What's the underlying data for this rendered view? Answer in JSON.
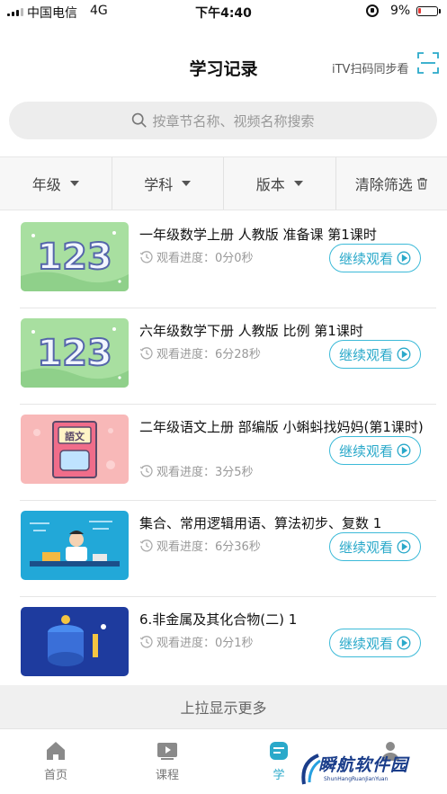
{
  "status_bar": {
    "carrier": "中国电信",
    "network": "4G",
    "time": "下午4:40",
    "battery": "9%"
  },
  "header": {
    "title": "学习记录",
    "scan_label": "iTV扫码同步看"
  },
  "search": {
    "placeholder": "按章节名称、视频名称搜索"
  },
  "filters": [
    {
      "label": "年级"
    },
    {
      "label": "学科"
    },
    {
      "label": "版本"
    },
    {
      "label": "清除筛选"
    }
  ],
  "records": [
    {
      "title": "一年级数学上册 人教版 准备课 第1课时",
      "progress_label": "观看进度：",
      "progress": "0分0秒",
      "action": "继续观看",
      "thumb": "math-123-green"
    },
    {
      "title": "六年级数学下册 人教版 比例 第1课时",
      "progress_label": "观看进度：",
      "progress": "6分28秒",
      "action": "继续观看",
      "thumb": "math-123-green"
    },
    {
      "title": "二年级语文上册 部编版 小蝌蚪找妈妈(第1课时)",
      "progress_label": "观看进度：",
      "progress": "3分5秒",
      "action": "继续观看",
      "thumb": "chinese-book-pink"
    },
    {
      "title": "集合、常用逻辑用语、算法初步、复数 1",
      "progress_label": "观看进度：",
      "progress": "6分36秒",
      "action": "继续观看",
      "thumb": "student-desk-blue"
    },
    {
      "title": "6.非金属及其化合物(二) 1",
      "progress_label": "观看进度：",
      "progress": "0分1秒",
      "action": "继续观看",
      "thumb": "chemistry-navy"
    }
  ],
  "load_more": "上拉显示更多",
  "tabs": [
    {
      "label": "首页",
      "icon": "home-icon"
    },
    {
      "label": "课程",
      "icon": "video-icon"
    },
    {
      "label": "学",
      "icon": "study-icon"
    },
    {
      "label": "",
      "icon": "profile-icon"
    }
  ],
  "watermark": {
    "text": "瞬航软件园",
    "sub": "ShunHangRuanJianYuan"
  },
  "colors": {
    "accent": "#2aa9ca",
    "button_border": "#3cbad8",
    "search_bg": "#ededed",
    "filter_bg": "#f7f7f7"
  }
}
